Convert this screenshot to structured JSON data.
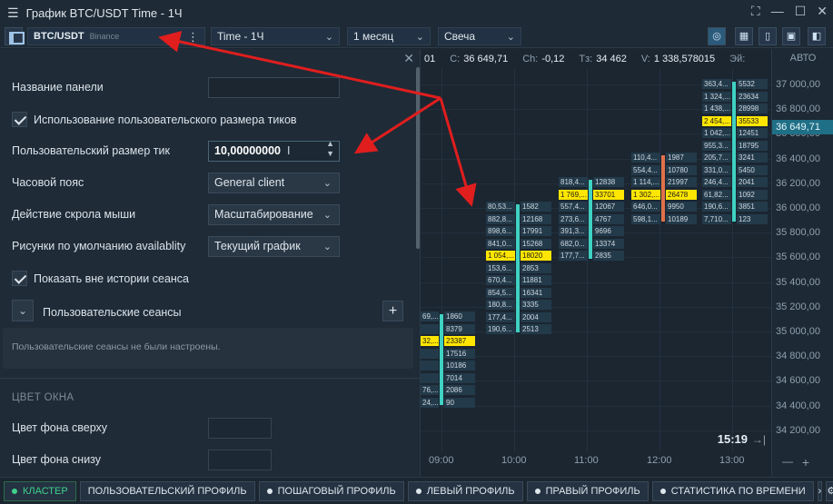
{
  "window": {
    "title": "График BTC/USDT Time - 1Ч",
    "controls": [
      "⛶",
      "—",
      "☐",
      "✕"
    ]
  },
  "toolbar": {
    "symbol": "BTC/USDT",
    "exchange": "Binance",
    "timeframe": "Time - 1Ч",
    "period": "1 месяц",
    "chart_type": "Свеча"
  },
  "chart": {
    "info": {
      "o_val": "01",
      "c_label": "C:",
      "c_val": "36 649,71",
      "ch_label": "Ch:",
      "ch_val": "-0,12",
      "tz_label": "Тз:",
      "tz_val": "34 462",
      "v_label": "V:",
      "v_val": "1 338,578015",
      "e_label": "Эй:"
    },
    "auto_label": "АВТО",
    "current_price": "36 649,71",
    "clock": "15:19",
    "prices": [
      "37 000,00",
      "36 800,00",
      "36 600,00",
      "36 400,00",
      "36 200,00",
      "36 000,00",
      "35 800,00",
      "35 600,00",
      "35 400,00",
      "35 200,00",
      "35 000,00",
      "34 800,00",
      "34 600,00",
      "34 400,00",
      "34 200,00"
    ],
    "times": [
      "09:00",
      "10:00",
      "11:00",
      "12:00",
      "13:00"
    ],
    "clusters": [
      {
        "rows": [
          [
            "69,...",
            "1860"
          ],
          [
            "",
            "8379"
          ],
          [
            "32,...",
            "23387"
          ],
          [
            "",
            "17516"
          ],
          [
            "",
            "10186"
          ],
          [
            "",
            "7014"
          ],
          [
            "76,...",
            "2086"
          ],
          [
            "24,...",
            "90"
          ]
        ],
        "hl": 2
      },
      {
        "rows": [
          [
            "80,53...",
            "1582"
          ],
          [
            "882,8...",
            "12168"
          ],
          [
            "898,6...",
            "17991"
          ],
          [
            "841,0...",
            "15268"
          ],
          [
            "1 054,...",
            "18020"
          ],
          [
            "153,6...",
            "2853"
          ],
          [
            "670,4...",
            "11881"
          ],
          [
            "854,5...",
            "16341"
          ],
          [
            "180,8...",
            "3335"
          ],
          [
            "177,4...",
            "2004"
          ],
          [
            "190,6...",
            "2513"
          ]
        ],
        "hl": 4
      },
      {
        "rows": [
          [
            "818,4...",
            "12838"
          ],
          [
            "1 769,...",
            "33701"
          ],
          [
            "557,4...",
            "12067"
          ],
          [
            "273,6...",
            "4767"
          ],
          [
            "391,3...",
            "9696"
          ],
          [
            "682,0...",
            "13374"
          ],
          [
            "177,7...",
            "2835"
          ]
        ],
        "hl": 1
      },
      {
        "rows": [
          [
            "110,4...",
            "1987"
          ],
          [
            "554,4...",
            "10780"
          ],
          [
            "1 114,...",
            "21997"
          ],
          [
            "1 302,...",
            "26478"
          ],
          [
            "646,0...",
            "9950"
          ],
          [
            "598,1...",
            "10189"
          ]
        ],
        "hl": 3
      },
      {
        "rows": [
          [
            "363,4...",
            "5532"
          ],
          [
            "1 324,...",
            "23634"
          ],
          [
            "1 438,...",
            "28998"
          ],
          [
            "2 454,...",
            "35533"
          ],
          [
            "1 042,...",
            "12451"
          ],
          [
            "955,3...",
            "18795"
          ],
          [
            "205,7...",
            "3241"
          ],
          [
            "331,0...",
            "5450"
          ],
          [
            "246,4...",
            "2041"
          ],
          [
            "61,82...",
            "1092"
          ],
          [
            "190,6...",
            "3851"
          ],
          [
            "7,710...",
            "123"
          ]
        ],
        "hl": 3
      }
    ]
  },
  "panel": {
    "panel_name_label": "Название панели",
    "panel_name_value": "",
    "custom_tick_checkbox_label": "Использование пользовательского размера тиков",
    "custom_tick_label": "Пользовательский размер тик",
    "custom_tick_value": "10,00000000",
    "timezone_label": "Часовой пояс",
    "timezone_value": "General client",
    "scroll_label": "Действие скрола мыши",
    "scroll_value": "Масштабирование",
    "drawings_label": "Рисунки по умолчанию availablity",
    "drawings_value": "Текущий график",
    "out_of_session_label": "Показать вне истории сеанса",
    "sessions_label": "Пользовательские сеансы",
    "sessions_empty": "Пользовательские сеансы не были настроены.",
    "window_color_section": "ЦВЕТ ОКНА",
    "bg_top_label": "Цвет фона сверху",
    "bg_bottom_label": "Цвет фона снизу"
  },
  "bottombar": {
    "tabs": [
      "КЛАСТЕР",
      "ПОЛЬЗОВАТЕЛЬСКИЙ ПРОФИЛЬ",
      "ПОШАГОВЫЙ ПРОФИЛЬ",
      "ЛЕВЫЙ ПРОФИЛЬ",
      "ПРАВЫЙ ПРОФИЛЬ",
      "СТАТИСТИКА ПО ВРЕМЕНИ"
    ]
  },
  "colors": {
    "accent": "#3fd1c2",
    "highlight": "#ffe600",
    "arrow": "#e01e1e",
    "active_tab": "#3fd18a"
  }
}
